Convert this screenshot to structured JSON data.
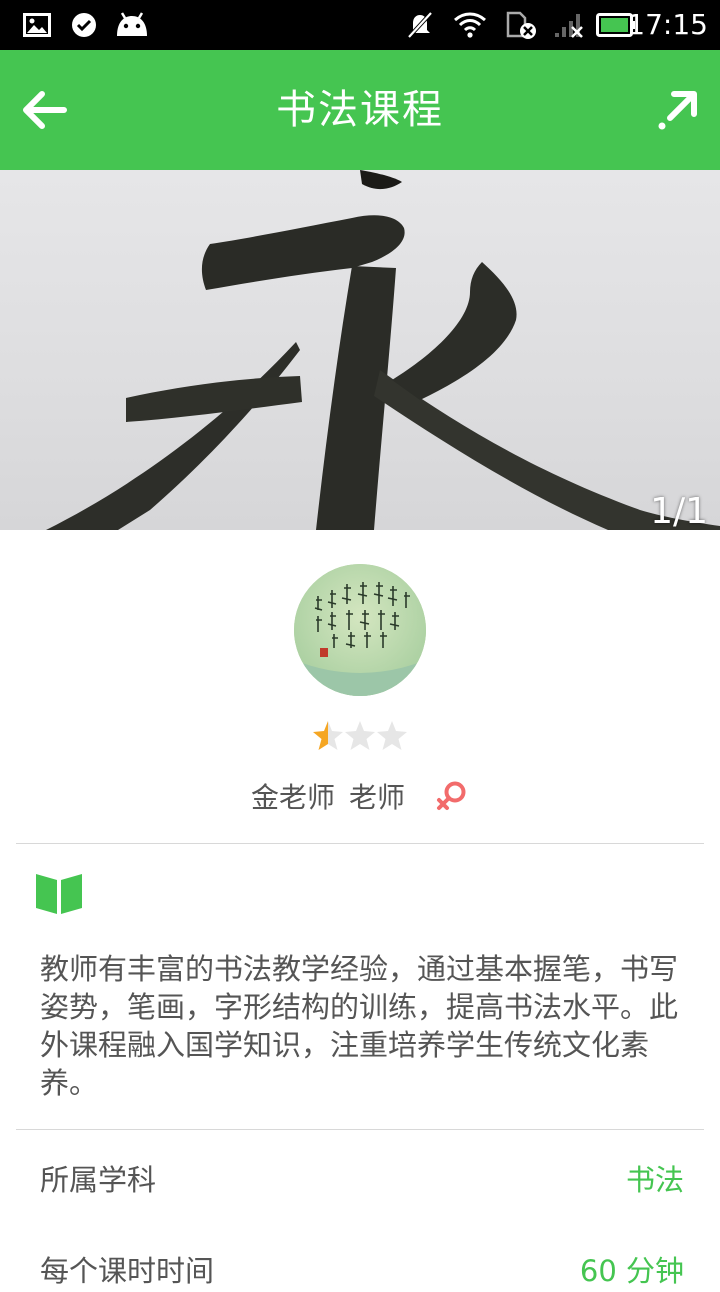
{
  "status_bar": {
    "time": "17:15",
    "icons": [
      "image-notification-icon",
      "check-notification-icon",
      "android-notification-icon",
      "mute-icon",
      "wifi-icon",
      "sim-icon",
      "signal-icon",
      "battery-icon"
    ],
    "colors": {
      "background": "#000000",
      "battery": "#45c551"
    }
  },
  "header": {
    "title": "书法课程",
    "back_icon": "back-arrow-icon",
    "share_icon": "share-icon",
    "color": "#45c551"
  },
  "banner": {
    "counter": "1/1"
  },
  "teacher": {
    "name": "金老师",
    "role": "老师",
    "rating": 0.5,
    "rating_max": 3,
    "gender_icon": "female-icon"
  },
  "course": {
    "description_icon": "book-icon",
    "description": "教师有丰富的书法教学经验，通过基本握笔，书写姿势，笔画，字形结构的训练，提高书法水平。此外课程融入国学知识，注重培养学生传统文化素养。"
  },
  "details": [
    {
      "label": "所属学科",
      "value": "书法"
    },
    {
      "label": "每个课时时间",
      "value": "60 分钟"
    }
  ]
}
